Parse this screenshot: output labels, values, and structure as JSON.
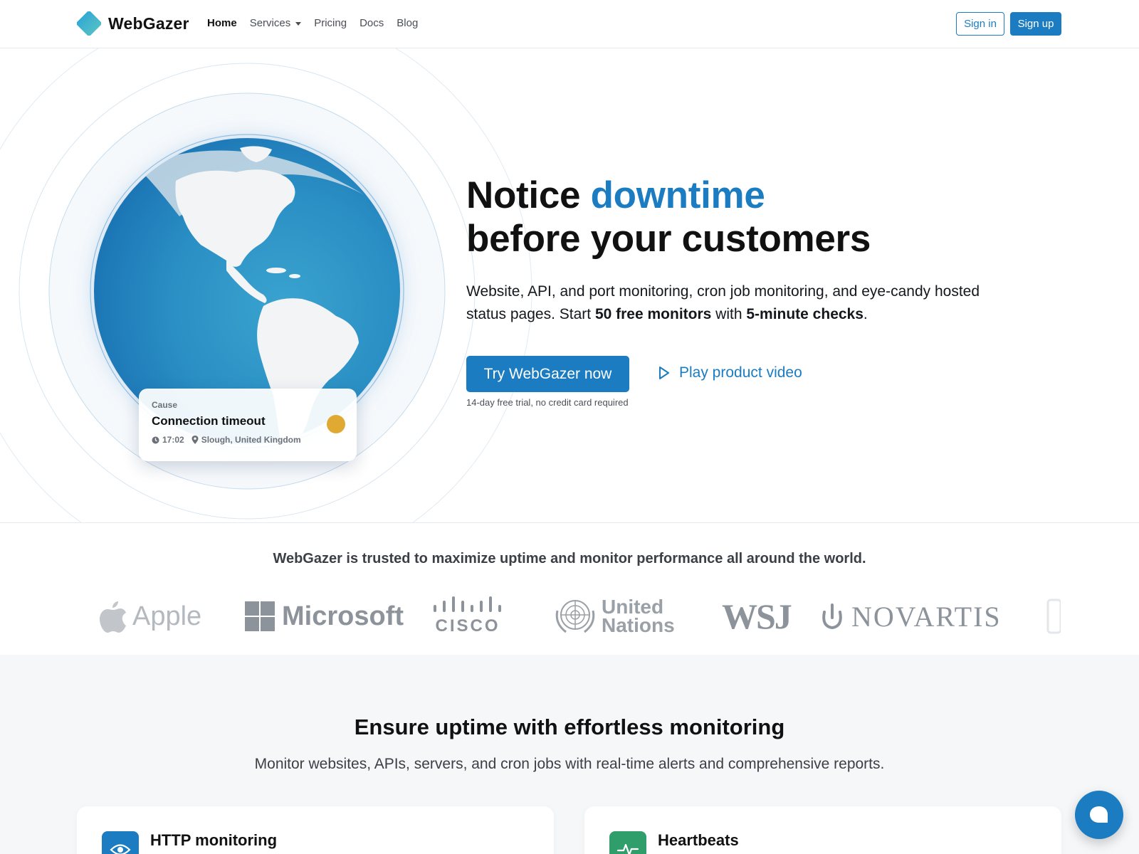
{
  "nav": {
    "brand": "WebGazer",
    "items": [
      {
        "label": "Home",
        "active": true
      },
      {
        "label": "Services",
        "dropdown": true
      },
      {
        "label": "Pricing"
      },
      {
        "label": "Docs"
      },
      {
        "label": "Blog"
      }
    ],
    "sign_in": "Sign in",
    "sign_up": "Sign up"
  },
  "hero": {
    "headline_pre": "Notice ",
    "headline_accent": "downtime",
    "headline_line2": "before your customers",
    "sub_part1": "Website, API, and port monitoring, cron job monitoring, and eye-candy hosted status pages. Start ",
    "sub_bold1": "50 free monitors",
    "sub_part2": " with ",
    "sub_bold2": "5-minute checks",
    "sub_part3": ".",
    "cta_primary": "Try WebGazer now",
    "cta_secondary": "Play product video",
    "trial_note": "14-day free trial, no credit card required"
  },
  "incident_card": {
    "label": "Cause",
    "title": "Connection timeout",
    "time": "17:02",
    "location": "Slough, United Kingdom",
    "status_color": "#e0a932"
  },
  "trusted": {
    "title": "WebGazer is trusted to maximize uptime and monitor performance all around the world.",
    "logos": {
      "apple": "Apple",
      "microsoft": "Microsoft",
      "cisco": "CISCO",
      "un_line1": "United",
      "un_line2": "Nations",
      "wsj": "WSJ",
      "novartis": "NOVARTIS"
    }
  },
  "features": {
    "title": "Ensure uptime with effortless monitoring",
    "subtitle": "Monitor websites, APIs, servers, and cron jobs with real-time alerts and comprehensive reports.",
    "cards": [
      {
        "title": "HTTP monitoring",
        "icon": "eye-icon",
        "color": "#1b7cc2"
      },
      {
        "title": "Heartbeats",
        "icon": "pulse-icon",
        "color": "#2f9e6a"
      }
    ]
  },
  "colors": {
    "accent": "#1b7cc2",
    "text": "#14171c",
    "muted": "#9aa0a7"
  }
}
